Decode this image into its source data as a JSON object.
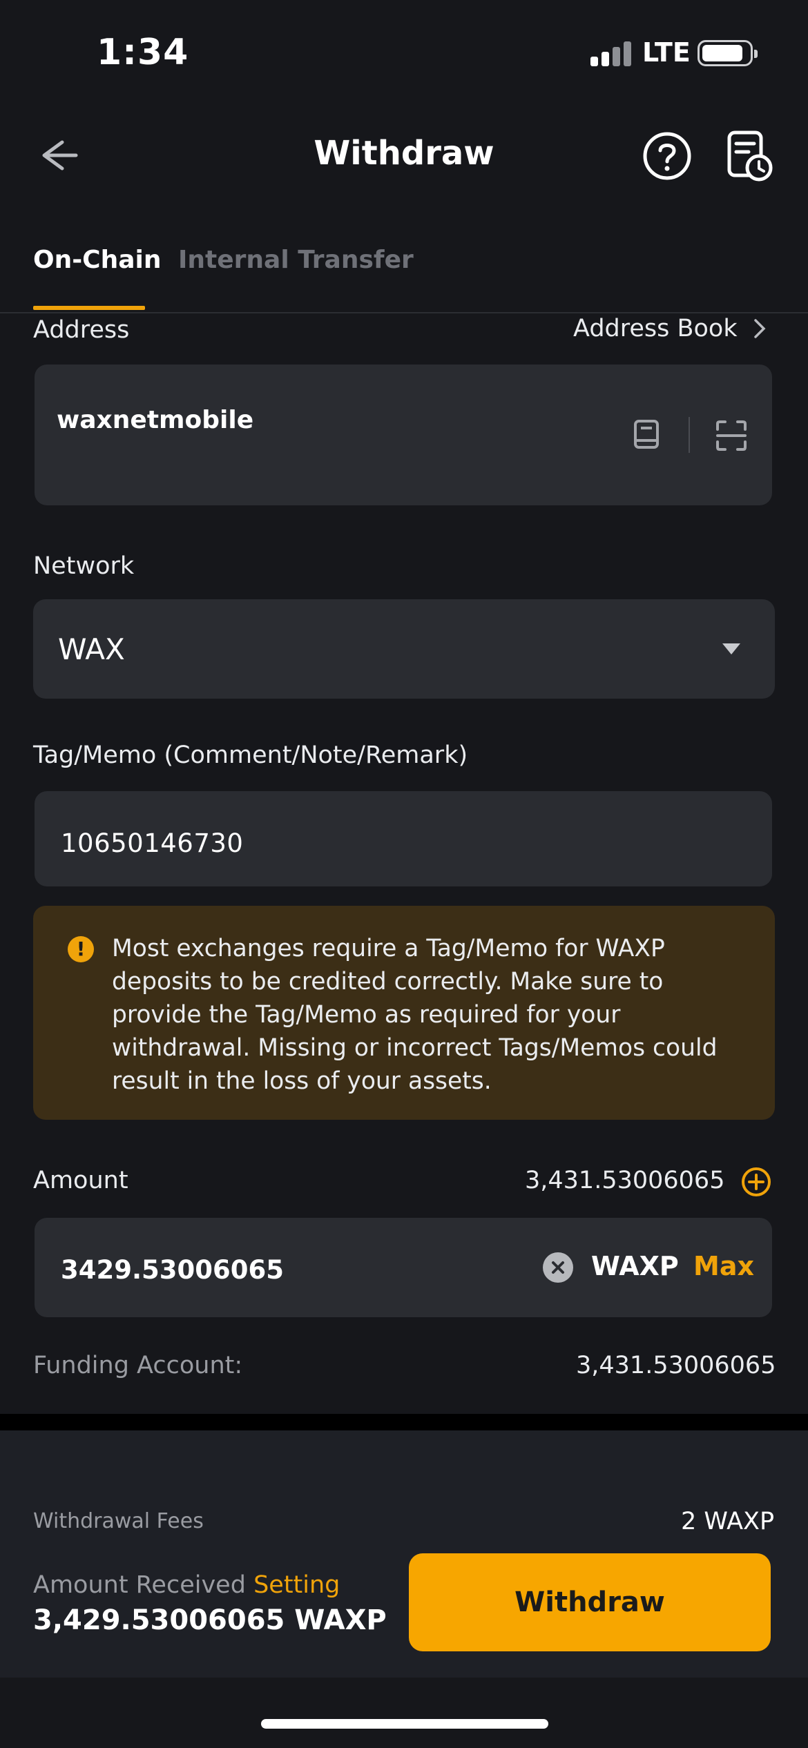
{
  "status_bar": {
    "time": "1:34",
    "network": "LTE"
  },
  "header": {
    "title": "Withdraw"
  },
  "tabs": [
    {
      "label": "On-Chain",
      "active": true
    },
    {
      "label": "Internal Transfer",
      "active": false
    }
  ],
  "address": {
    "label": "Address",
    "address_book_label": "Address Book",
    "value": "waxnetmobile"
  },
  "network": {
    "label": "Network",
    "value": "WAX"
  },
  "tag": {
    "label": "Tag/Memo (Comment/Note/Remark)",
    "value": "10650146730"
  },
  "warning": {
    "text": "Most exchanges require a Tag/Memo for WAXP deposits to be credited correctly. Make sure to provide the Tag/Memo as required for your withdrawal. Missing or incorrect Tags/Memos could result in the loss of your assets."
  },
  "amount": {
    "label": "Amount",
    "available": "3,431.53006065",
    "value": "3429.53006065",
    "unit": "WAXP",
    "max_label": "Max"
  },
  "funding": {
    "label": "Funding Account:",
    "value": "3,431.53006065"
  },
  "footer": {
    "fee_label": "Withdrawal Fees",
    "fee_value": "2 WAXP",
    "received_label": "Amount Received",
    "setting_label": "Setting",
    "received_value": "3,429.53006065 WAXP",
    "withdraw_label": "Withdraw"
  },
  "colors": {
    "background": "#16171b",
    "field": "#2a2c31",
    "accent": "#f0a30a",
    "button": "#f7a600",
    "warning_bg": "#3c2e16"
  }
}
